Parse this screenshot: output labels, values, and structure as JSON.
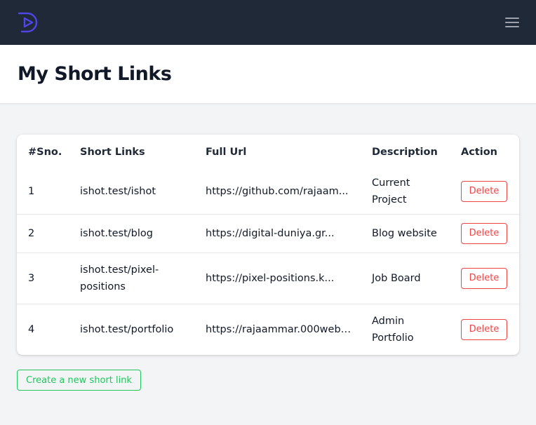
{
  "page": {
    "title": "My Short Links"
  },
  "navbar": {
    "logo_icon": "play-logo-icon",
    "menu_icon": "hamburger-menu-icon",
    "background": "#1f2937",
    "logo_color": "#4f46e5"
  },
  "table": {
    "headers": [
      "#Sno.",
      "Short Links",
      "Full Url",
      "Description",
      "Action"
    ],
    "rows": [
      {
        "sno": "1",
        "short_link": "ishot.test/ishot",
        "full_url": "https://github.com/rajaam...",
        "description": "Current Project",
        "action": "Delete"
      },
      {
        "sno": "2",
        "short_link": "ishot.test/blog",
        "full_url": "https://digital-duniya.gr...",
        "description": "Blog website",
        "action": "Delete"
      },
      {
        "sno": "3",
        "short_link": "ishot.test/pixel-positions",
        "full_url": "https://pixel-positions.k...",
        "description": "Job Board",
        "action": "Delete"
      },
      {
        "sno": "4",
        "short_link": "ishot.test/portfolio",
        "full_url": "https://rajaammar.000webh...",
        "description": "Admin Portfolio",
        "action": "Delete"
      }
    ]
  },
  "create_button": {
    "label": "Create a new short link",
    "color": "#22c55e"
  },
  "colors": {
    "delete": "#ef4444",
    "page_background": "#f3f4f6"
  }
}
